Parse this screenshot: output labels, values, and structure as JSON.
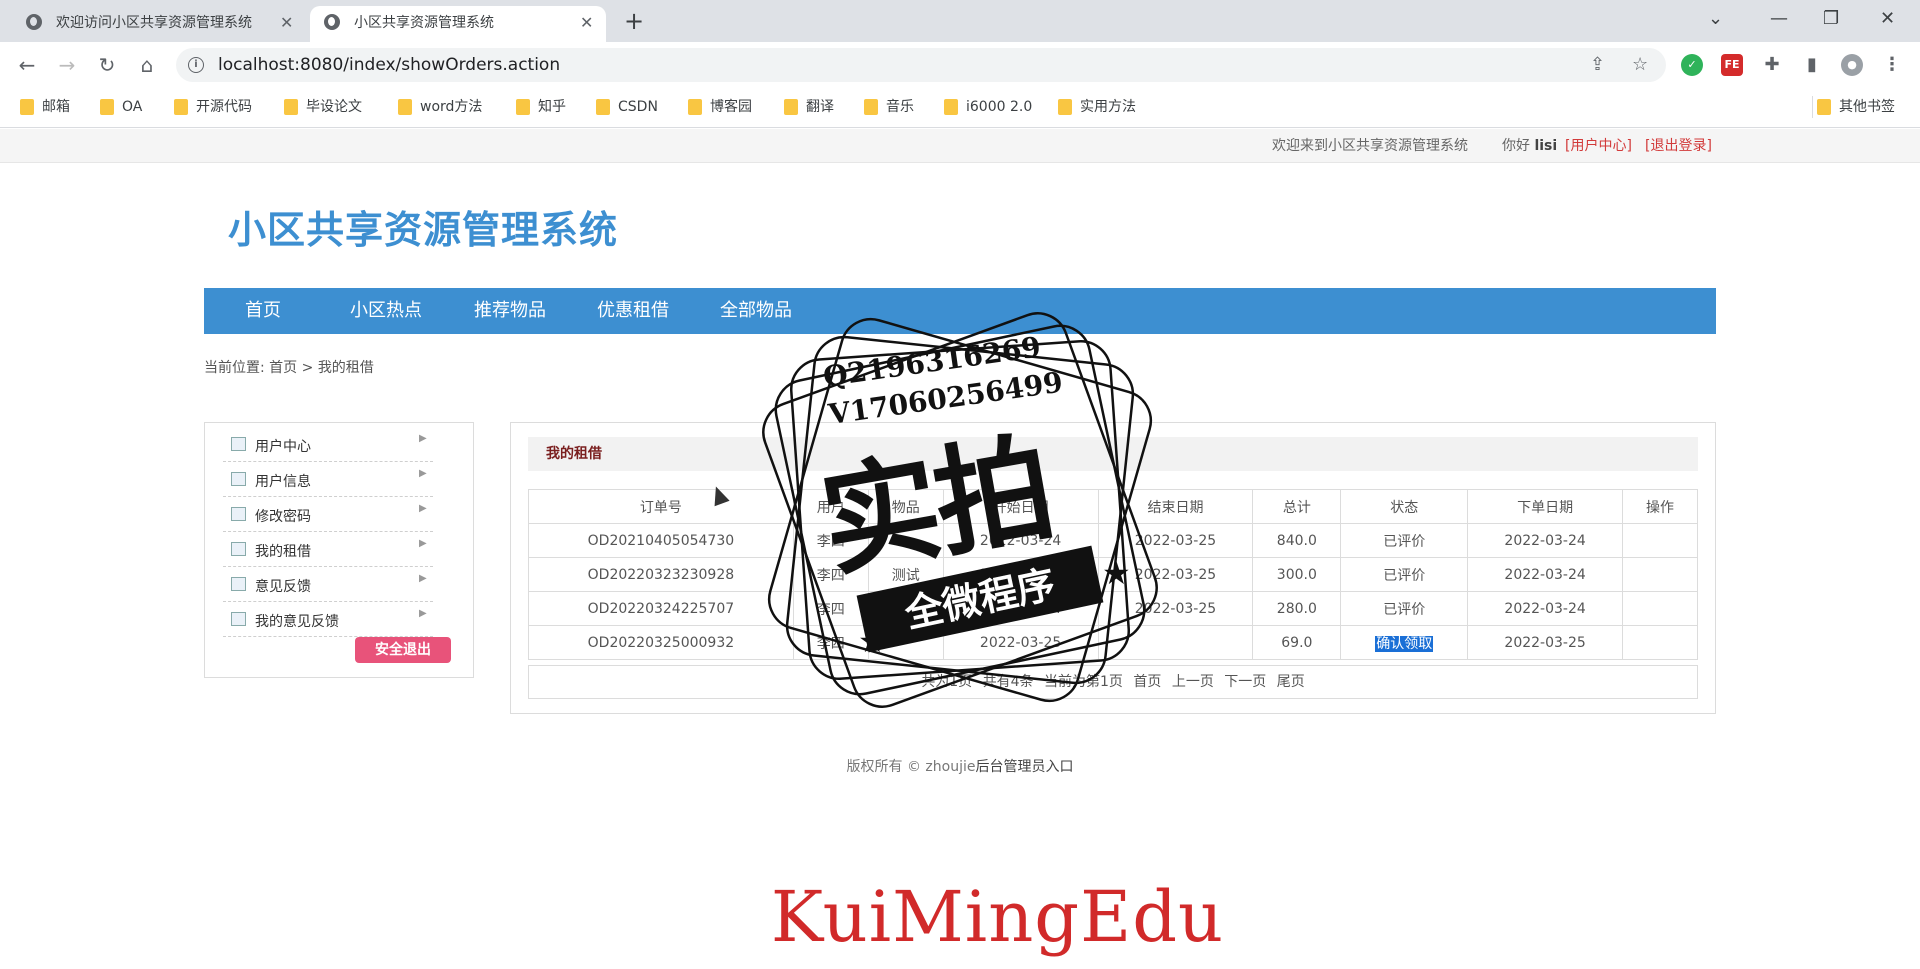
{
  "browser": {
    "tabs": [
      {
        "title": "欢迎访问小区共享资源管理系统"
      },
      {
        "title": "小区共享资源管理系统"
      }
    ],
    "url": "localhost:8080/index/showOrders.action",
    "bookmarks": [
      "邮箱",
      "OA",
      "开源代码",
      "毕设论文",
      "word方法",
      "知乎",
      "CSDN",
      "博客园",
      "翻译",
      "音乐",
      "i6000 2.0",
      "实用方法"
    ],
    "other_bookmarks": "其他书签"
  },
  "topbar": {
    "welcome": "欢迎来到小区共享资源管理系统",
    "hello": "你好",
    "username": "lisi",
    "user_center": "[用户中心]",
    "logout": "[退出登录]"
  },
  "site": {
    "logo": "小区共享资源管理系统",
    "nav": [
      "首页",
      "小区热点",
      "推荐物品",
      "优惠租借",
      "全部物品"
    ]
  },
  "breadcrumb": {
    "prefix": "当前位置:",
    "home": "首页",
    "sep": ">",
    "current": "我的租借"
  },
  "sidebar": {
    "items": [
      "用户中心",
      "用户信息",
      "修改密码",
      "我的租借",
      "意见反馈",
      "我的意见反馈"
    ],
    "logout_button": "安全退出"
  },
  "orders": {
    "panel_title": "我的租借",
    "columns": [
      "订单号",
      "用户",
      "物品",
      "开始日期",
      "结束日期",
      "总计",
      "状态",
      "下单日期",
      "操作"
    ],
    "rows": [
      {
        "id": "OD20210405054730",
        "user": "李四",
        "item": "",
        "start": "2022-03-24",
        "end": "2022-03-25",
        "total": "840.0",
        "status": "已评价",
        "date": "2022-03-24",
        "op": ""
      },
      {
        "id": "OD20220323230928",
        "user": "李四",
        "item": "测试",
        "start": "2022-03-24",
        "end": "2022-03-25",
        "total": "300.0",
        "status": "已评价",
        "date": "2022-03-24",
        "op": ""
      },
      {
        "id": "OD20220324225707",
        "user": "李四",
        "item": "",
        "start": "2022-03-24",
        "end": "2022-03-25",
        "total": "280.0",
        "status": "已评价",
        "date": "2022-03-24",
        "op": ""
      },
      {
        "id": "OD20220325000932",
        "user": "李四",
        "item": "",
        "start": "2022-03-25",
        "end": "",
        "total": "69.0",
        "status": "确认领取",
        "date": "2022-03-25",
        "op": ""
      }
    ],
    "pager": [
      "共为1页",
      "共有4条",
      "当前为第1页",
      "首页",
      "上一页",
      "下一页",
      "尾页"
    ]
  },
  "footer": {
    "copyright": "版权所有 © zhoujie",
    "admin_link": "后台管理员入口"
  },
  "watermark": {
    "qq": "Q2196316269",
    "wechat": "V17060256499",
    "big_text": "实拍",
    "ribbon": "全微程序",
    "brand": "KuiMingEdu"
  }
}
